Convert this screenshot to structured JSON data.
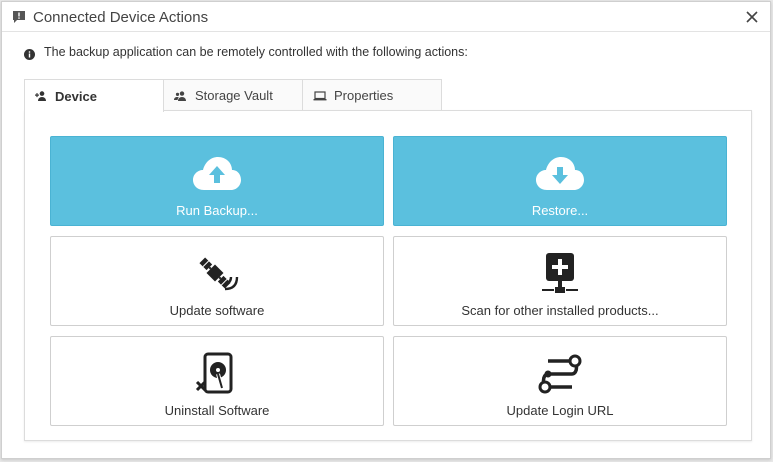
{
  "window": {
    "title": "Connected Device Actions",
    "title_icon": "chat-alert-icon",
    "close_icon": "close-icon"
  },
  "info": {
    "icon": "info-icon",
    "text": "The backup application can be remotely controlled with the following actions:"
  },
  "tabs": [
    {
      "label": "Device",
      "icon": "user-plus-icon",
      "active": true
    },
    {
      "label": "Storage Vault",
      "icon": "users-icon",
      "active": false
    },
    {
      "label": "Properties",
      "icon": "laptop-icon",
      "active": false
    }
  ],
  "actions": [
    {
      "label": "Run Backup...",
      "icon": "cloud-upload-icon",
      "primary": true
    },
    {
      "label": "Restore...",
      "icon": "cloud-download-icon",
      "primary": true
    },
    {
      "label": "Update software",
      "icon": "satellite-icon",
      "primary": false
    },
    {
      "label": "Scan for other installed products...",
      "icon": "network-add-icon",
      "primary": false
    },
    {
      "label": "Uninstall Software",
      "icon": "uninstall-disk-icon",
      "primary": false
    },
    {
      "label": "Update Login URL",
      "icon": "route-icon",
      "primary": false
    }
  ],
  "colors": {
    "primary": "#5bc0de",
    "text": "#333333"
  }
}
